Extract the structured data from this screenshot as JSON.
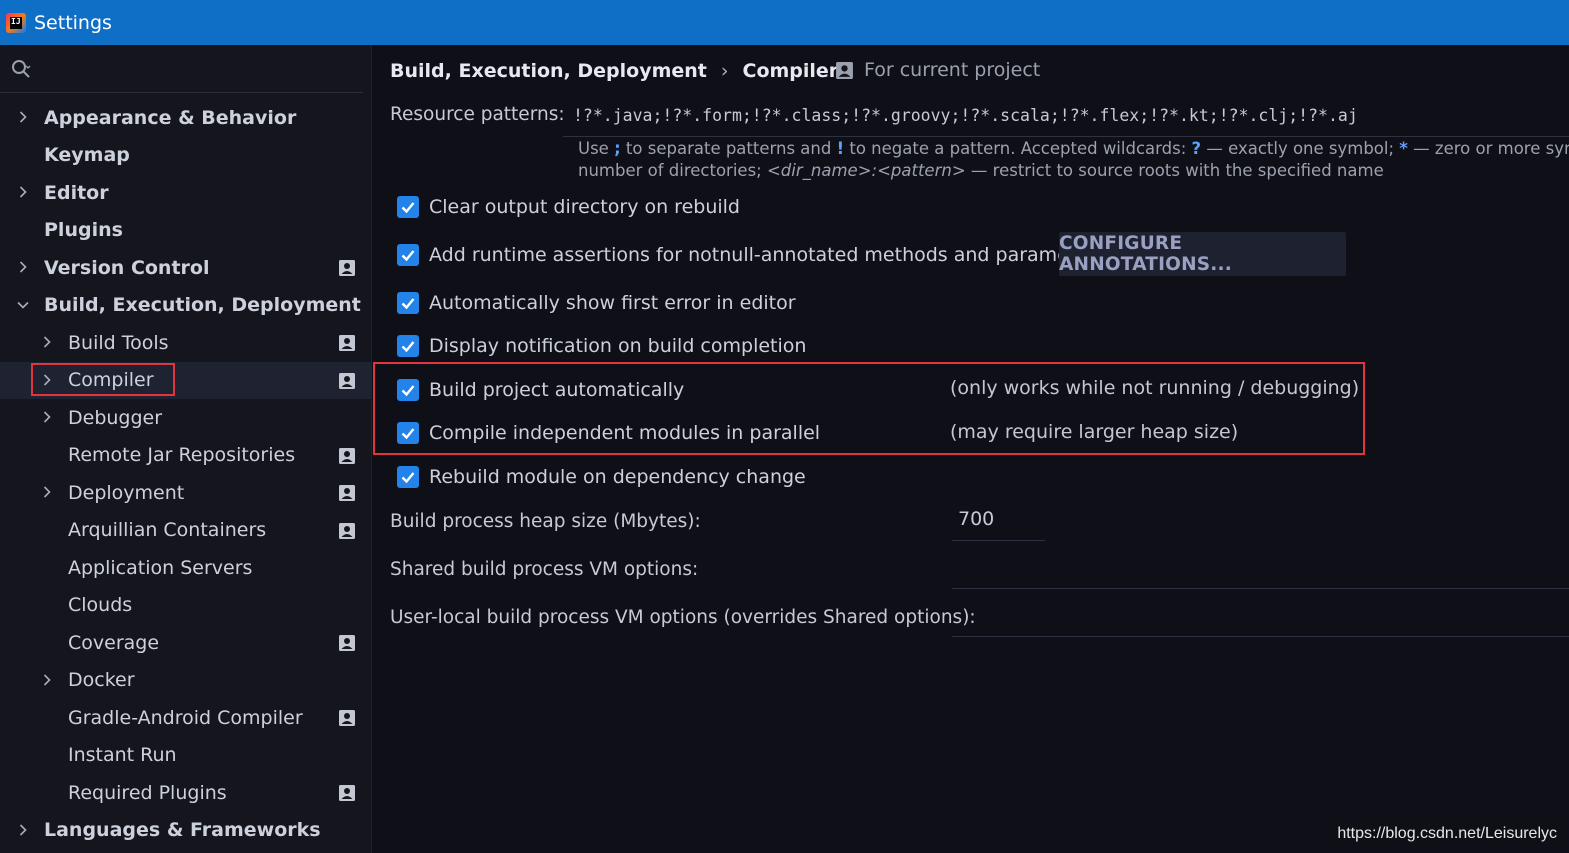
{
  "window": {
    "title": "Settings",
    "icon_text": "IJ"
  },
  "search": {
    "placeholder": ""
  },
  "sidebar": {
    "items": [
      {
        "label": "Appearance & Behavior",
        "level": 0,
        "bold": true,
        "chevron": "right",
        "project": false
      },
      {
        "label": "Keymap",
        "level": 0,
        "bold": true,
        "chevron": "none",
        "project": false
      },
      {
        "label": "Editor",
        "level": 0,
        "bold": true,
        "chevron": "right",
        "project": false
      },
      {
        "label": "Plugins",
        "level": 0,
        "bold": true,
        "chevron": "none",
        "project": false
      },
      {
        "label": "Version Control",
        "level": 0,
        "bold": true,
        "chevron": "right",
        "project": true
      },
      {
        "label": "Build, Execution, Deployment",
        "level": 0,
        "bold": true,
        "chevron": "down",
        "project": false
      },
      {
        "label": "Build Tools",
        "level": 1,
        "bold": false,
        "chevron": "right",
        "project": true
      },
      {
        "label": "Compiler",
        "level": 1,
        "bold": false,
        "chevron": "right",
        "project": true,
        "selected": true
      },
      {
        "label": "Debugger",
        "level": 1,
        "bold": false,
        "chevron": "right",
        "project": false
      },
      {
        "label": "Remote Jar Repositories",
        "level": 1,
        "bold": false,
        "chevron": "none",
        "project": true
      },
      {
        "label": "Deployment",
        "level": 1,
        "bold": false,
        "chevron": "right",
        "project": true
      },
      {
        "label": "Arquillian Containers",
        "level": 1,
        "bold": false,
        "chevron": "none",
        "project": true
      },
      {
        "label": "Application Servers",
        "level": 1,
        "bold": false,
        "chevron": "none",
        "project": false
      },
      {
        "label": "Clouds",
        "level": 1,
        "bold": false,
        "chevron": "none",
        "project": false
      },
      {
        "label": "Coverage",
        "level": 1,
        "bold": false,
        "chevron": "none",
        "project": true
      },
      {
        "label": "Docker",
        "level": 1,
        "bold": false,
        "chevron": "right",
        "project": false
      },
      {
        "label": "Gradle-Android Compiler",
        "level": 1,
        "bold": false,
        "chevron": "none",
        "project": true
      },
      {
        "label": "Instant Run",
        "level": 1,
        "bold": false,
        "chevron": "none",
        "project": false
      },
      {
        "label": "Required Plugins",
        "level": 1,
        "bold": false,
        "chevron": "none",
        "project": true
      },
      {
        "label": "Languages & Frameworks",
        "level": 0,
        "bold": true,
        "chevron": "right",
        "project": false
      }
    ]
  },
  "breadcrumb": {
    "parent": "Build, Execution, Deployment",
    "separator": "›",
    "current": "Compiler"
  },
  "scope": {
    "label": "For current project"
  },
  "resource_patterns": {
    "label": "Resource patterns:",
    "value": "!?*.java;!?*.form;!?*.class;!?*.groovy;!?*.scala;!?*.flex;!?*.kt;!?*.clj;!?*.aj",
    "hint": {
      "p1": "Use ",
      "semi": ";",
      "p2": " to separate patterns and ",
      "bang": "!",
      "p3": " to negate a pattern. Accepted wildcards: ",
      "q": "?",
      "p4": " — exactly one symbol; ",
      "star": "*",
      "p5": " — zero or more symbo",
      "line2a": "number of directories; ",
      "dir": "<dir_name>:<pattern>",
      "line2b": " — restrict to source roots with the specified name"
    }
  },
  "options": {
    "clear_output": "Clear output directory on rebuild",
    "runtime_assertions": "Add runtime assertions for notnull-annotated methods and parameters",
    "configure_annotations": "CONFIGURE ANNOTATIONS...",
    "show_first_error": "Automatically show first error in editor",
    "display_notification": "Display notification on build completion",
    "build_auto": "Build project automatically",
    "build_auto_note": "(only works while not running / debugging)",
    "compile_parallel": "Compile independent modules in parallel",
    "compile_parallel_note": "(may require larger heap size)",
    "rebuild_module": "Rebuild module on dependency change"
  },
  "fields": {
    "heap_label": "Build process heap size (Mbytes):",
    "heap_value": "700",
    "shared_vm_label": "Shared build process VM options:",
    "shared_vm_value": "",
    "user_vm_label": "User-local build process VM options (overrides Shared options):",
    "user_vm_value": ""
  },
  "watermark": "https://blog.csdn.net/Leisurelyc",
  "colors": {
    "titlebar": "#0f6fc6",
    "checkbox": "#2383e8",
    "highlight": "#e0343f"
  }
}
